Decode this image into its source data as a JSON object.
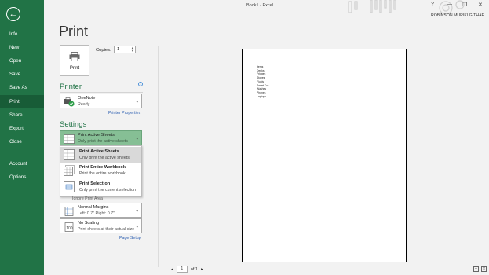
{
  "window": {
    "title": "Book1 - Excel",
    "user": "ROBINSON MURIKI GITHAE",
    "controls": [
      "?",
      "—",
      "❐",
      "✕"
    ]
  },
  "sidebar": {
    "back_icon": "back-arrow-icon",
    "items": [
      {
        "label": "Info"
      },
      {
        "label": "New"
      },
      {
        "label": "Open"
      },
      {
        "label": "Save"
      },
      {
        "label": "Save As"
      },
      {
        "label": "Print",
        "active": true
      },
      {
        "label": "Share"
      },
      {
        "label": "Export"
      },
      {
        "label": "Close"
      },
      {
        "label": "Account"
      },
      {
        "label": "Options"
      }
    ]
  },
  "print": {
    "heading": "Print",
    "button_label": "Print",
    "copies_label": "Copies:",
    "copies_value": "1"
  },
  "printer": {
    "section_title": "Printer",
    "name": "OneNote",
    "status": "Ready",
    "properties_link": "Printer Properties",
    "info_icon": "i"
  },
  "settings": {
    "section_title": "Settings",
    "scope": {
      "main": "Print Active Sheets",
      "sub": "Only print the active sheets"
    },
    "menu": [
      {
        "main": "Print Active Sheets",
        "sub": "Only print the active sheets",
        "selected": true
      },
      {
        "main": "Print Entire Workbook",
        "sub": "Print the entire workbook"
      },
      {
        "main": "Print Selection",
        "sub": "Only print the current selection"
      }
    ],
    "ignore_print_area": "Ignore Print Area",
    "margins": {
      "main": "Normal Margins",
      "sub": "Left:  0.7\"    Right:  0.7\""
    },
    "scaling": {
      "main": "No Scaling",
      "sub": "Print sheets at their actual size"
    },
    "page_setup_link": "Page Setup"
  },
  "preview": {
    "lines": [
      "Items",
      "Deeks",
      "Fridges",
      "Stoves",
      "Fluids",
      "Smart Tvs",
      "Washes",
      "Phones",
      "Laptops"
    ],
    "pager": {
      "prev": "◂",
      "page": "1",
      "of": "of 1",
      "next": "▸"
    }
  },
  "colors": {
    "accent": "#217346",
    "accent_dark": "#185c37",
    "link": "#2a5db0"
  }
}
